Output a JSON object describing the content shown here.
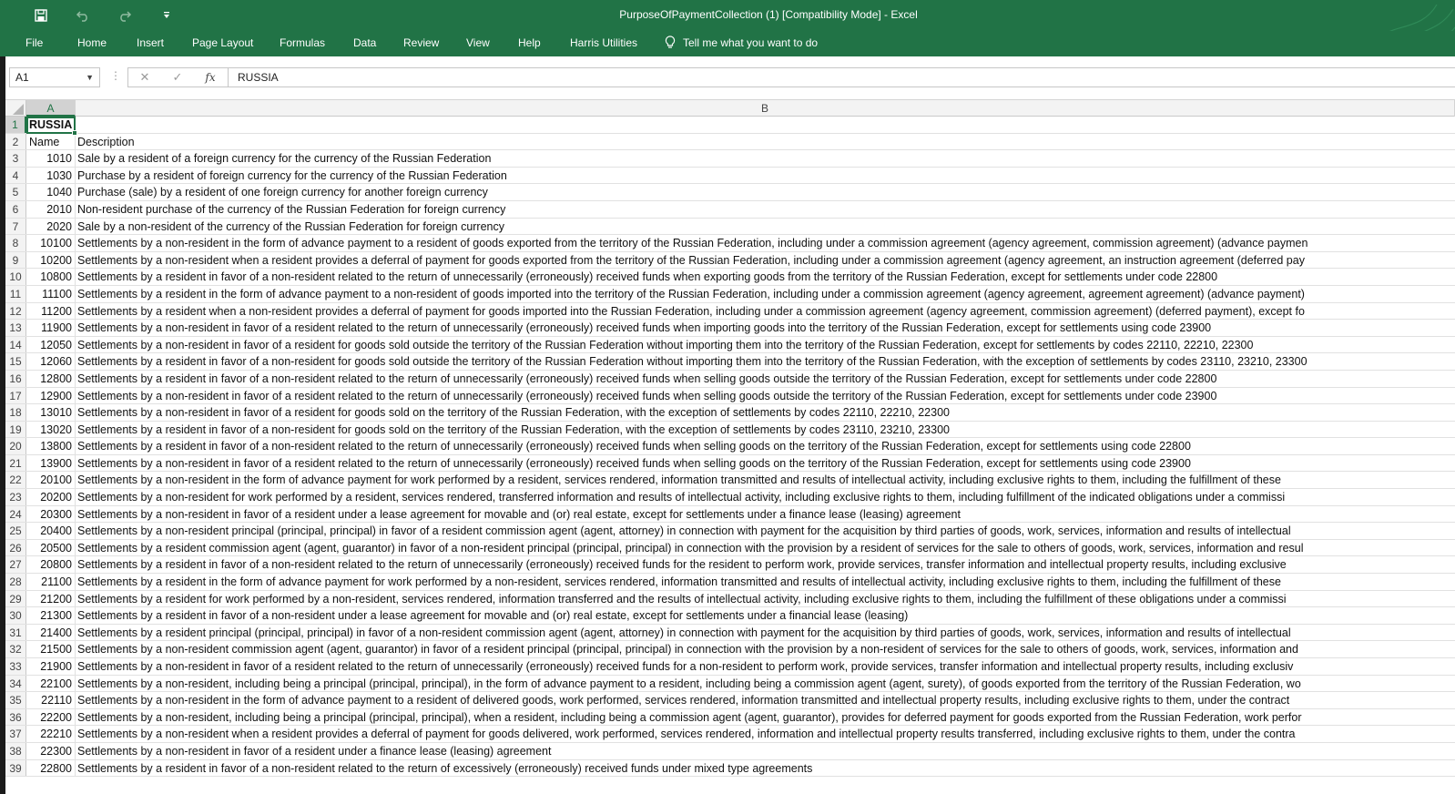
{
  "window": {
    "title": "PurposeOfPaymentCollection (1)  [Compatibility Mode]  -  Excel"
  },
  "qat": {
    "save_icon": "save-icon",
    "undo_icon": "undo-icon",
    "redo_icon": "redo-icon",
    "customize_icon": "customize-qat-icon"
  },
  "ribbon": {
    "tabs": [
      "File",
      "Home",
      "Insert",
      "Page Layout",
      "Formulas",
      "Data",
      "Review",
      "View",
      "Help",
      "Harris Utilities"
    ],
    "tell_me": "Tell me what you want to do"
  },
  "formula_bar": {
    "name_box": "A1",
    "formula": "RUSSIA"
  },
  "columns": [
    "A",
    "B"
  ],
  "selected_cell": "A1",
  "colors": {
    "accent": "#217346"
  },
  "rows": [
    {
      "n": "1",
      "a": "RUSSIA",
      "b": ""
    },
    {
      "n": "2",
      "a": "Name",
      "b": "Description"
    },
    {
      "n": "3",
      "a": "1010",
      "b": "Sale by a resident of a foreign currency for the currency of the Russian Federation"
    },
    {
      "n": "4",
      "a": "1030",
      "b": "Purchase by a resident of foreign currency for the currency of the Russian Federation"
    },
    {
      "n": "5",
      "a": "1040",
      "b": "Purchase (sale) by a resident of one foreign currency for another foreign currency"
    },
    {
      "n": "6",
      "a": "2010",
      "b": "Non-resident purchase of the currency of the Russian Federation for foreign currency"
    },
    {
      "n": "7",
      "a": "2020",
      "b": "Sale by a non-resident of the currency of the Russian Federation for foreign currency"
    },
    {
      "n": "8",
      "a": "10100",
      "b": "Settlements by a non-resident in the form of advance payment to a resident of goods exported from the territory of the Russian Federation, including under a commission agreement (agency agreement, commission agreement) (advance paymen"
    },
    {
      "n": "9",
      "a": "10200",
      "b": "Settlements by a non-resident when a resident provides a deferral of payment for goods exported from the territory of the Russian Federation, including under a commission agreement (agency agreement, an instruction agreement (deferred pay"
    },
    {
      "n": "10",
      "a": "10800",
      "b": "Settlements by a resident in favor of a non-resident related to the return of unnecessarily (erroneously) received funds when exporting goods from the territory of the Russian Federation, except for settlements under code 22800"
    },
    {
      "n": "11",
      "a": "11100",
      "b": "Settlements by a resident in the form of advance payment to a non-resident of goods imported into the territory of the Russian Federation, including under a commission agreement (agency agreement, agreement agreement) (advance payment)"
    },
    {
      "n": "12",
      "a": "11200",
      "b": "Settlements by a resident when a non-resident provides a deferral of payment for goods imported into the Russian Federation, including under a commission agreement (agency agreement, commission agreement) (deferred payment), except fo"
    },
    {
      "n": "13",
      "a": "11900",
      "b": "Settlements by a non-resident in favor of a resident related to the return of unnecessarily (erroneously) received funds when importing goods into the territory of the Russian Federation, except for settlements using code 23900"
    },
    {
      "n": "14",
      "a": "12050",
      "b": "Settlements by a non-resident in favor of a resident for goods sold outside the territory of the Russian Federation without importing them into the territory of the Russian Federation, except for settlements by codes 22110, 22210, 22300"
    },
    {
      "n": "15",
      "a": "12060",
      "b": "Settlements by a resident in favor of a non-resident for goods sold outside the territory of the Russian Federation without importing them into the territory of the Russian Federation, with the exception of settlements by codes 23110, 23210, 23300"
    },
    {
      "n": "16",
      "a": "12800",
      "b": "Settlements by a resident in favor of a non-resident related to the return of unnecessarily (erroneously) received funds when selling goods outside the territory of the Russian Federation, except for settlements under code 22800"
    },
    {
      "n": "17",
      "a": "12900",
      "b": "Settlements by a non-resident in favor of a resident related to the return of unnecessarily (erroneously) received funds when selling goods outside the territory of the Russian Federation, except for settlements under code 23900"
    },
    {
      "n": "18",
      "a": "13010",
      "b": "Settlements by a non-resident in favor of a resident for goods sold on the territory of the Russian Federation, with the exception of settlements by codes 22110, 22210, 22300"
    },
    {
      "n": "19",
      "a": "13020",
      "b": "Settlements by a resident in favor of a non-resident for goods sold on the territory of the Russian Federation, with the exception of settlements by codes 23110, 23210, 23300"
    },
    {
      "n": "20",
      "a": "13800",
      "b": "Settlements by a resident in favor of a non-resident related to the return of unnecessarily (erroneously) received funds when selling goods on the territory of the Russian Federation, except for settlements using code 22800"
    },
    {
      "n": "21",
      "a": "13900",
      "b": "Settlements by a non-resident in favor of a resident related to the return of unnecessarily (erroneously) received funds when selling goods on the territory of the Russian Federation, except for settlements using code 23900"
    },
    {
      "n": "22",
      "a": "20100",
      "b": "Settlements by a non-resident in the form of advance payment for work performed by a resident, services rendered, information transmitted and results of intellectual activity, including exclusive rights to them, including the fulfillment of these"
    },
    {
      "n": "23",
      "a": "20200",
      "b": "Settlements by a non-resident for work performed by a resident, services rendered, transferred information and results of intellectual activity, including exclusive rights to them, including fulfillment of the indicated obligations under a commissi"
    },
    {
      "n": "24",
      "a": "20300",
      "b": "Settlements by a non-resident in favor of a resident under a lease agreement for movable and (or) real estate, except for settlements under a finance lease (leasing) agreement"
    },
    {
      "n": "25",
      "a": "20400",
      "b": "Settlements by a non-resident principal (principal, principal) in favor of a resident commission agent (agent, attorney) in connection with payment for the acquisition by third parties of goods, work, services, information and results of intellectual"
    },
    {
      "n": "26",
      "a": "20500",
      "b": "Settlements by a resident commission agent (agent, guarantor) in favor of a non-resident principal (principal, principal) in connection with the provision by a resident of services for the sale to others of goods, work, services, information and resul"
    },
    {
      "n": "27",
      "a": "20800",
      "b": "Settlements by a resident in favor of a non-resident related to the return of unnecessarily (erroneously) received funds for the resident to perform work, provide services, transfer information and intellectual property results, including exclusive"
    },
    {
      "n": "28",
      "a": "21100",
      "b": "Settlements by a resident in the form of advance payment for work performed by a non-resident, services rendered, information transmitted and results of intellectual activity, including exclusive rights to them, including the fulfillment of these"
    },
    {
      "n": "29",
      "a": "21200",
      "b": "Settlements by a resident for work performed by a non-resident, services rendered, information transferred and the results of intellectual activity, including exclusive rights to them, including the fulfillment of these obligations under a commissi"
    },
    {
      "n": "30",
      "a": "21300",
      "b": "Settlements by a resident in favor of a non-resident under a lease agreement for movable and (or) real estate, except for settlements under a financial lease (leasing)"
    },
    {
      "n": "31",
      "a": "21400",
      "b": "Settlements by a resident principal (principal, principal) in favor of a non-resident commission agent (agent, attorney) in connection with payment for the acquisition by third parties of goods, work, services, information and results of intellectual"
    },
    {
      "n": "32",
      "a": "21500",
      "b": "Settlements by a non-resident commission agent (agent, guarantor) in favor of a resident principal (principal, principal) in connection with the provision by a non-resident of services for the sale to others of goods, work, services, information and"
    },
    {
      "n": "33",
      "a": "21900",
      "b": "Settlements by a non-resident in favor of a resident related to the return of unnecessarily (erroneously) received funds for a non-resident to perform work, provide services, transfer information and intellectual property results, including exclusiv"
    },
    {
      "n": "34",
      "a": "22100",
      "b": "Settlements by a non-resident, including being a principal (principal, principal), in the form of advance payment to a resident, including being a commission agent (agent, surety), of goods exported from the territory of the Russian Federation, wo"
    },
    {
      "n": "35",
      "a": "22110",
      "b": "Settlements by a non-resident in the form of advance payment to a resident of delivered goods, work performed, services rendered, information transmitted and intellectual property results, including exclusive rights to them, under the contract"
    },
    {
      "n": "36",
      "a": "22200",
      "b": "Settlements by a non-resident, including being a principal (principal, principal), when a resident, including being a commission agent (agent, guarantor), provides for deferred payment for goods exported from the Russian Federation, work perfor"
    },
    {
      "n": "37",
      "a": "22210",
      "b": "Settlements by a non-resident when a resident provides a deferral of payment for goods delivered, work performed, services rendered, information and intellectual property results transferred, including exclusive rights to them, under the contra"
    },
    {
      "n": "38",
      "a": "22300",
      "b": "Settlements by a non-resident in favor of a resident under a finance lease (leasing) agreement"
    },
    {
      "n": "39",
      "a": "22800",
      "b": "Settlements by a resident in favor of a non-resident related to the return of excessively (erroneously) received funds under mixed type agreements"
    }
  ]
}
